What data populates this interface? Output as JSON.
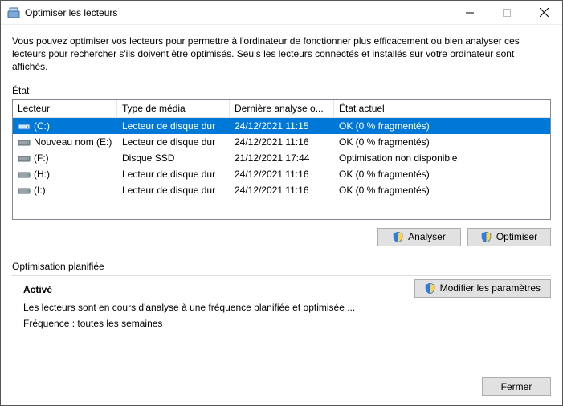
{
  "window": {
    "title": "Optimiser les lecteurs"
  },
  "intro": "Vous pouvez optimiser vos lecteurs pour permettre à l'ordinateur de fonctionner plus efficacement ou bien analyser ces lecteurs pour rechercher s'ils doivent être optimisés. Seuls les lecteurs connectés et installés sur votre ordinateur sont affichés.",
  "state_label": "État",
  "columns": {
    "drive": "Lecteur",
    "media": "Type de média",
    "last": "Dernière analyse o...",
    "status": "État actuel"
  },
  "rows": [
    {
      "name": "(C:)",
      "selected": true,
      "media": "Lecteur de disque dur",
      "last": "24/12/2021 11:15",
      "status": "OK (0 % fragmentés)"
    },
    {
      "name": "Nouveau nom (E:)",
      "selected": false,
      "media": "Lecteur de disque dur",
      "last": "24/12/2021 11:16",
      "status": "OK (0 % fragmentés)"
    },
    {
      "name": "(F:)",
      "selected": false,
      "media": "Disque SSD",
      "last": "21/12/2021 17:44",
      "status": "Optimisation non disponible"
    },
    {
      "name": "(H:)",
      "selected": false,
      "media": "Lecteur de disque dur",
      "last": "24/12/2021 11:16",
      "status": "OK (0 % fragmentés)"
    },
    {
      "name": "(I:)",
      "selected": false,
      "media": "Lecteur de disque dur",
      "last": "24/12/2021 11:16",
      "status": "OK (0 % fragmentés)"
    }
  ],
  "buttons": {
    "analyze": "Analyser",
    "optimize": "Optimiser",
    "modify": "Modifier les paramètres",
    "close": "Fermer"
  },
  "schedule": {
    "title": "Optimisation planifiée",
    "enabled": "Activé",
    "desc": "Les lecteurs sont en cours d'analyse à une fréquence planifiée et optimisée ...",
    "freq": "Fréquence : toutes les semaines"
  }
}
